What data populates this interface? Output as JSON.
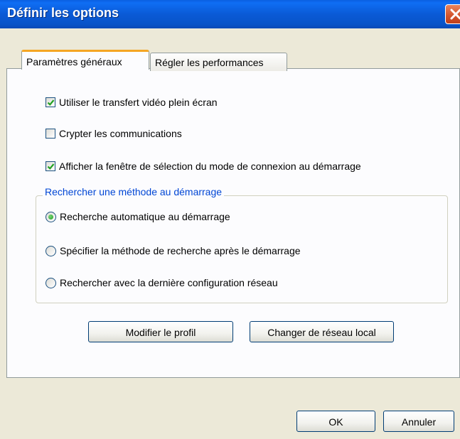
{
  "window": {
    "title": "Définir les options"
  },
  "tabs": [
    {
      "label": "Paramètres généraux"
    },
    {
      "label": "Régler les performances"
    }
  ],
  "options": [
    {
      "label": "Utiliser le transfert vidéo plein écran",
      "checked": true
    },
    {
      "label": "Crypter les communications",
      "checked": false
    },
    {
      "label": "Afficher la fenêtre de sélection du mode de connexion au démarrage",
      "checked": true
    }
  ],
  "search_group": {
    "legend": "Rechercher une méthode au démarrage",
    "options": [
      {
        "label": "Recherche automatique au démarrage",
        "selected": true
      },
      {
        "label": "Spécifier la méthode de recherche après le démarrage",
        "selected": false
      },
      {
        "label": "Rechercher avec la dernière configuration réseau",
        "selected": false
      }
    ]
  },
  "buttons": {
    "modify_profile": "Modifier le profil",
    "change_lan": "Changer de réseau local",
    "ok": "OK",
    "cancel": "Annuler"
  },
  "colors": {
    "titlebar": "#0a5ad6",
    "accent_tab": "#f5a623",
    "group_legend": "#0046d5",
    "check_mark": "#21a121"
  }
}
